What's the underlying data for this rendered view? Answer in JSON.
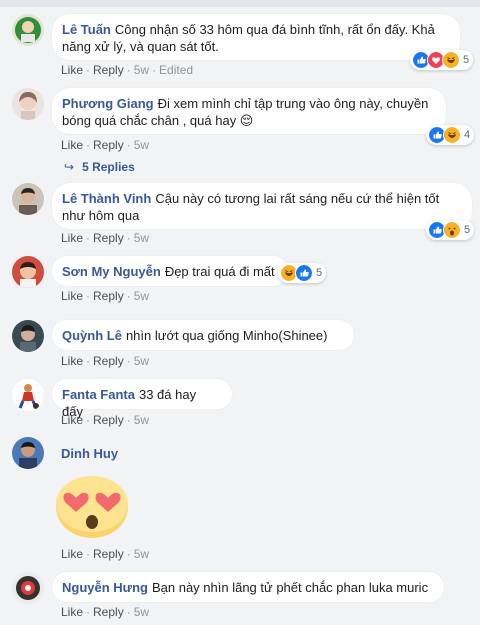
{
  "comments": [
    {
      "author": "Lê Tuấn",
      "text": "Công nhận số 33 hôm qua đá bình tĩnh, rất ổn đấy. Khả năng xử lý, và quan sát tốt.",
      "like": "Like",
      "reply": "Reply",
      "time": "5w",
      "edited": "Edited",
      "reactions": [
        "like-icon",
        "love-icon",
        "haha-icon"
      ],
      "reaction_count": "5"
    },
    {
      "author": "Phương Giang",
      "text": "Đi xem mình chỉ tập trung vào ông này, chuyền bóng quá chắc chân , quá hay 😌",
      "like": "Like",
      "reply": "Reply",
      "time": "5w",
      "reactions": [
        "like-icon",
        "haha-icon"
      ],
      "reaction_count": "4",
      "replies_label": "5 Replies"
    },
    {
      "author": "Lê Thành Vinh",
      "text": "Cậu này có tương lai rất sáng nếu cứ thể hiện tốt như hôm qua",
      "like": "Like",
      "reply": "Reply",
      "time": "5w",
      "reactions": [
        "like-icon",
        "wow-icon"
      ],
      "reaction_count": "5"
    },
    {
      "author": "Sơn My Nguyễn",
      "text": "Đẹp trai quá đi mất",
      "like": "Like",
      "reply": "Reply",
      "time": "5w",
      "reactions": [
        "haha-icon",
        "like-icon"
      ],
      "reaction_count": "5"
    },
    {
      "author": "Quỳnh Lê",
      "text": "nhìn lướt qua giống Minho(Shinee)",
      "like": "Like",
      "reply": "Reply",
      "time": "5w"
    },
    {
      "author": "Fanta Fanta",
      "text": "33 đá hay đấy",
      "like": "Like",
      "reply": "Reply",
      "time": "5w"
    },
    {
      "author": "Dinh Huy",
      "text": "",
      "sticker": "heart-eyes-emoji",
      "like": "Like",
      "reply": "Reply",
      "time": "5w"
    },
    {
      "author": "Nguyễn Hưng",
      "text": "Bạn này nhìn lãng tử phết chắc phan luka muric",
      "like": "Like",
      "reply": "Reply",
      "time": "5w"
    }
  ],
  "colors": {
    "background": "#f2f3f5",
    "bubble": "#ffffff",
    "author": "#385898",
    "meta": "#90949c",
    "like_blue": "#1877f2",
    "love_red": "#f33e58",
    "haha_yellow": "#f7b125"
  }
}
